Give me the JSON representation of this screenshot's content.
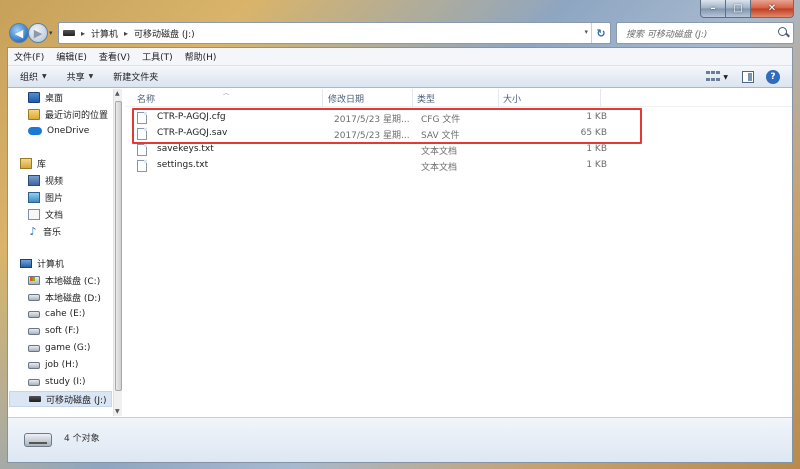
{
  "window": {
    "caption": {
      "minimize": "–",
      "maximize": "□",
      "close": "✕"
    }
  },
  "nav": {
    "back": "◀",
    "forward": "▶",
    "dropdown": "▾",
    "breadcrumbs": [
      "计算机",
      "可移动磁盘 (J:)"
    ],
    "separator": "▸",
    "search_placeholder": "搜索 可移动磁盘 (J:)"
  },
  "menu": [
    "文件(F)",
    "编辑(E)",
    "查看(V)",
    "工具(T)",
    "帮助(H)"
  ],
  "toolbar": {
    "organize": "组织",
    "share": "共享",
    "new_folder": "新建文件夹",
    "arrow": "▼",
    "help": "?"
  },
  "sidebar": {
    "favorites": [
      {
        "label": "桌面",
        "icon": "desktop-icon"
      },
      {
        "label": "最近访问的位置",
        "icon": "recent-places-icon"
      },
      {
        "label": "OneDrive",
        "icon": "onedrive-icon"
      }
    ],
    "library_label": "库",
    "libraries": [
      {
        "label": "视频",
        "icon": "video-icon"
      },
      {
        "label": "图片",
        "icon": "pictures-icon"
      },
      {
        "label": "文档",
        "icon": "documents-icon"
      },
      {
        "label": "音乐",
        "icon": "music-icon"
      }
    ],
    "computer_label": "计算机",
    "drives": [
      {
        "label": "本地磁盘 (C:)"
      },
      {
        "label": "本地磁盘 (D:)"
      },
      {
        "label": "cahe (E:)"
      },
      {
        "label": "soft (F:)"
      },
      {
        "label": "game (G:)"
      },
      {
        "label": "job (H:)"
      },
      {
        "label": "study (I:)"
      },
      {
        "label": "可移动磁盘 (J:)"
      }
    ]
  },
  "columns": {
    "name": "名称",
    "modified": "修改日期",
    "type": "类型",
    "size": "大小"
  },
  "files": [
    {
      "name": "CTR-P-AGQJ.cfg",
      "date": "2017/5/23 星期...",
      "type": "CFG 文件",
      "size": "1 KB"
    },
    {
      "name": "CTR-P-AGQJ.sav",
      "date": "2017/5/23 星期...",
      "type": "SAV 文件",
      "size": "65 KB"
    },
    {
      "name": "savekeys.txt",
      "date": "",
      "type": "文本文档",
      "size": "1 KB"
    },
    {
      "name": "settings.txt",
      "date": "",
      "type": "文本文档",
      "size": "1 KB"
    }
  ],
  "status": {
    "item_count": "4 个对象"
  },
  "colors": {
    "highlight": "#e53935",
    "selection": "#dbe6f4"
  }
}
